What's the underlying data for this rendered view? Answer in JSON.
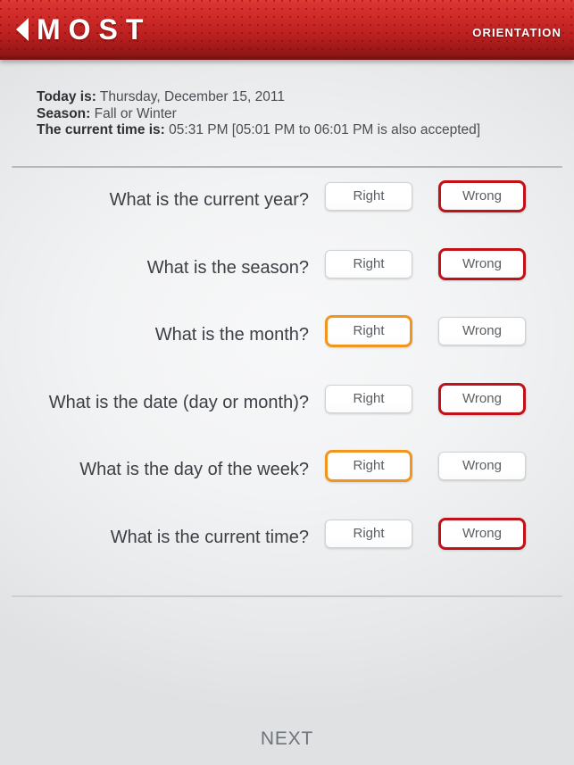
{
  "header": {
    "back_icon": "back-triangle-icon",
    "brand": "MOST",
    "section": "ORIENTATION",
    "accent_red": "#c02a26"
  },
  "info": {
    "today_label": "Today is:",
    "today_value": "Thursday, December 15, 2011",
    "season_label": "Season:",
    "season_value": "Fall or Winter",
    "time_label": "The current time is:",
    "time_value": "05:31 PM [05:01 PM to 06:01 PM is also accepted]"
  },
  "options": {
    "right": "Right",
    "wrong": "Wrong",
    "selected_right_color": "#f1951e",
    "selected_wrong_color": "#c01218"
  },
  "questions": [
    {
      "text": "What is the current year?",
      "selected": "wrong"
    },
    {
      "text": "What is the season?",
      "selected": "wrong"
    },
    {
      "text": "What is the month?",
      "selected": "right"
    },
    {
      "text": "What is the date (day or month)?",
      "selected": "wrong"
    },
    {
      "text": "What is the day of the week?",
      "selected": "right"
    },
    {
      "text": "What is the current time?",
      "selected": "wrong"
    }
  ],
  "footer": {
    "next_label": "NEXT"
  }
}
